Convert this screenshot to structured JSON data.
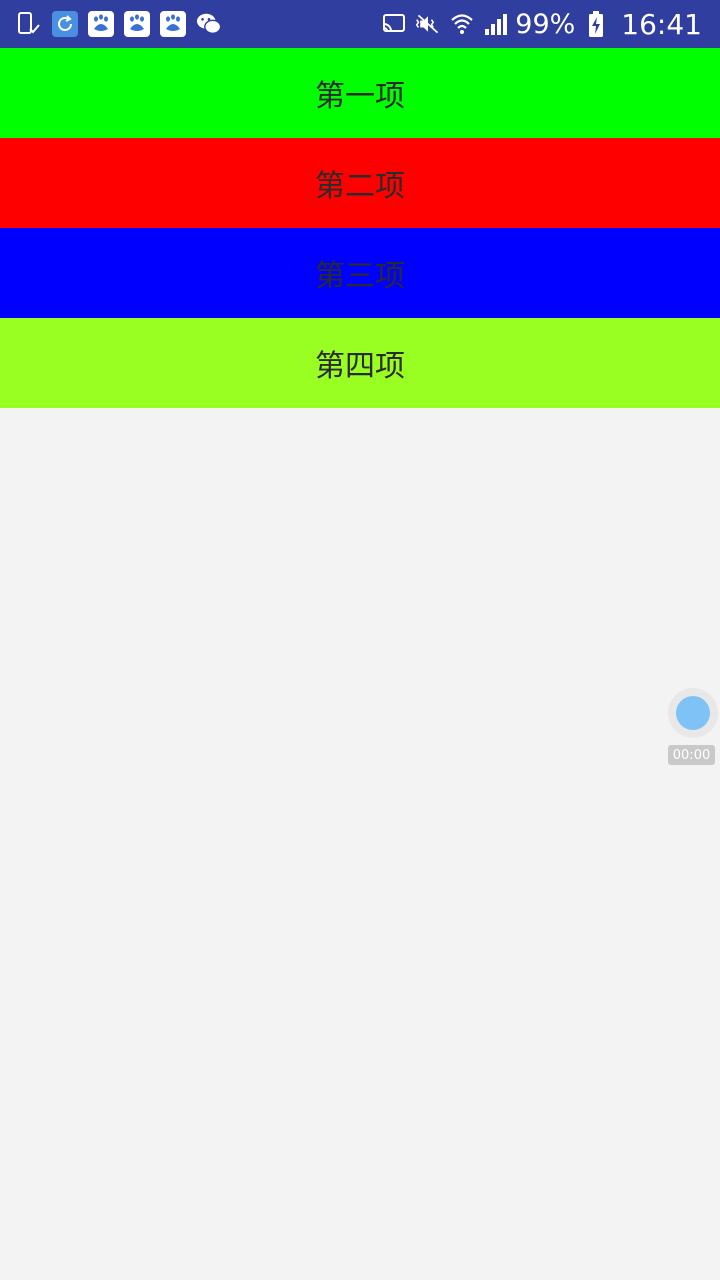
{
  "status_bar": {
    "battery": "99%",
    "time": "16:41",
    "background_color": "#303f9f",
    "left_icons": [
      "phone-check-icon",
      "sync-app-icon",
      "baidu-paw-icon",
      "baidu-paw-icon",
      "baidu-paw-icon",
      "wechat-icon"
    ],
    "right_icons": [
      "cast-icon",
      "mute-vibrate-icon",
      "wifi-icon",
      "cellular-signal-icon",
      "battery-charging-icon"
    ]
  },
  "list": {
    "items": [
      {
        "label": "第一项",
        "color": "#00ff00"
      },
      {
        "label": "第二项",
        "color": "#ff0000"
      },
      {
        "label": "第三项",
        "color": "#0000ff"
      },
      {
        "label": "第四项",
        "color": "#99ff22"
      }
    ]
  },
  "recorder": {
    "timer": "00:00",
    "dot_color": "#7fc2f5"
  }
}
